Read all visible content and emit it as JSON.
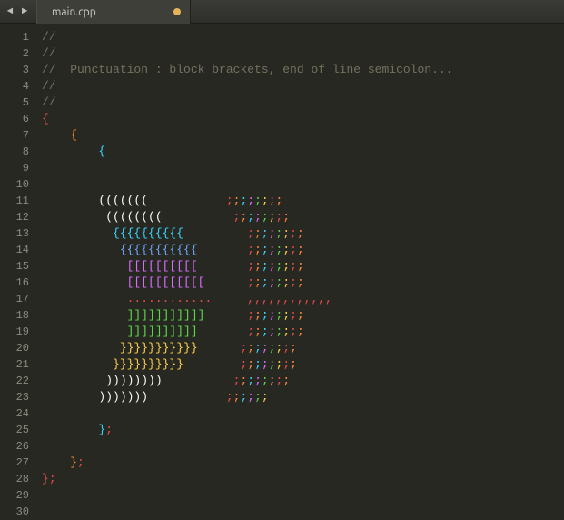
{
  "tabbar": {
    "prev_arrow": "◄",
    "next_arrow": "►",
    "tab_title": "main.cpp",
    "dirty_tooltip": "Unsaved changes"
  },
  "colors": {
    "accent_orange_dot": "#e6b35a",
    "comment": "#75715e",
    "background": "#272822"
  },
  "editor": {
    "line_count": 30,
    "lines": [
      {
        "kind": "comment",
        "text": "//"
      },
      {
        "kind": "comment",
        "text": "//"
      },
      {
        "kind": "comment",
        "text": "//  Punctuation : block brackets, end of line semicolon..."
      },
      {
        "kind": "comment",
        "text": "//"
      },
      {
        "kind": "comment",
        "text": "//"
      },
      {
        "kind": "code",
        "indent": 0,
        "segments": [
          {
            "c": "red",
            "t": "{"
          }
        ]
      },
      {
        "kind": "code",
        "indent": 4,
        "segments": [
          {
            "c": "orange",
            "t": "{"
          }
        ]
      },
      {
        "kind": "code",
        "indent": 8,
        "segments": [
          {
            "c": "cy",
            "t": "{"
          }
        ]
      },
      {
        "kind": "blank"
      },
      {
        "kind": "blank"
      },
      {
        "kind": "code",
        "indent": 8,
        "segments": [
          {
            "c": "wi",
            "t": "((((((("
          },
          {
            "c": "wi",
            "t": "           "
          },
          {
            "c": "red",
            "t": ";"
          },
          {
            "c": "orange",
            "t": ";"
          },
          {
            "c": "cy",
            "t": ";"
          },
          {
            "c": "mg",
            "t": ";"
          },
          {
            "c": "gr",
            "t": ";"
          },
          {
            "c": "yl",
            "t": ";"
          },
          {
            "c": "red",
            "t": ";"
          },
          {
            "c": "orange",
            "t": ";"
          }
        ]
      },
      {
        "kind": "code",
        "indent": 9,
        "segments": [
          {
            "c": "wi",
            "t": "(((((((("
          },
          {
            "c": "wi",
            "t": "          "
          },
          {
            "c": "red",
            "t": ";"
          },
          {
            "c": "orange",
            "t": ";"
          },
          {
            "c": "cy",
            "t": ";"
          },
          {
            "c": "mg",
            "t": ";"
          },
          {
            "c": "gr",
            "t": ";"
          },
          {
            "c": "yl",
            "t": ";"
          },
          {
            "c": "red",
            "t": ";"
          },
          {
            "c": "orange",
            "t": ";"
          }
        ]
      },
      {
        "kind": "code",
        "indent": 10,
        "segments": [
          {
            "c": "cy",
            "t": "{{{{{{{{{{"
          },
          {
            "c": "wi",
            "t": "         "
          },
          {
            "c": "red",
            "t": ";"
          },
          {
            "c": "orange",
            "t": ";"
          },
          {
            "c": "cy",
            "t": ";"
          },
          {
            "c": "mg",
            "t": ";"
          },
          {
            "c": "gr",
            "t": ";"
          },
          {
            "c": "yl",
            "t": ";"
          },
          {
            "c": "red",
            "t": ";"
          },
          {
            "c": "orange",
            "t": ";"
          }
        ]
      },
      {
        "kind": "code",
        "indent": 11,
        "segments": [
          {
            "c": "d2b",
            "t": "{{{{{{{{{{{"
          },
          {
            "c": "wi",
            "t": "       "
          },
          {
            "c": "red",
            "t": ";"
          },
          {
            "c": "orange",
            "t": ";"
          },
          {
            "c": "cy",
            "t": ";"
          },
          {
            "c": "mg",
            "t": ";"
          },
          {
            "c": "gr",
            "t": ";"
          },
          {
            "c": "yl",
            "t": ";"
          },
          {
            "c": "red",
            "t": ";"
          },
          {
            "c": "orange",
            "t": ";"
          }
        ]
      },
      {
        "kind": "code",
        "indent": 12,
        "segments": [
          {
            "c": "mg",
            "t": "[[[[[[[[[["
          },
          {
            "c": "wi",
            "t": "       "
          },
          {
            "c": "red",
            "t": ";"
          },
          {
            "c": "orange",
            "t": ";"
          },
          {
            "c": "cy",
            "t": ";"
          },
          {
            "c": "mg",
            "t": ";"
          },
          {
            "c": "gr",
            "t": ";"
          },
          {
            "c": "yl",
            "t": ";"
          },
          {
            "c": "red",
            "t": ";"
          },
          {
            "c": "orange",
            "t": ";"
          }
        ]
      },
      {
        "kind": "code",
        "indent": 12,
        "segments": [
          {
            "c": "mg",
            "t": "[[[[[[[[[[["
          },
          {
            "c": "wi",
            "t": "      "
          },
          {
            "c": "red",
            "t": ";"
          },
          {
            "c": "orange",
            "t": ";"
          },
          {
            "c": "cy",
            "t": ";"
          },
          {
            "c": "mg",
            "t": ";"
          },
          {
            "c": "gr",
            "t": ";"
          },
          {
            "c": "yl",
            "t": ";"
          },
          {
            "c": "red",
            "t": ";"
          },
          {
            "c": "orange",
            "t": ";"
          }
        ]
      },
      {
        "kind": "code",
        "indent": 12,
        "segments": [
          {
            "c": "red",
            "t": "............"
          },
          {
            "c": "wi",
            "t": "     "
          },
          {
            "c": "red",
            "t": ",,,,,,,,,,,,"
          }
        ]
      },
      {
        "kind": "code",
        "indent": 12,
        "segments": [
          {
            "c": "gr",
            "t": "]]]]]]]]]]]"
          },
          {
            "c": "wi",
            "t": "      "
          },
          {
            "c": "red",
            "t": ";"
          },
          {
            "c": "orange",
            "t": ";"
          },
          {
            "c": "cy",
            "t": ";"
          },
          {
            "c": "mg",
            "t": ";"
          },
          {
            "c": "gr",
            "t": ";"
          },
          {
            "c": "yl",
            "t": ";"
          },
          {
            "c": "red",
            "t": ";"
          },
          {
            "c": "orange",
            "t": ";"
          }
        ]
      },
      {
        "kind": "code",
        "indent": 12,
        "segments": [
          {
            "c": "gr",
            "t": "]]]]]]]]]]"
          },
          {
            "c": "wi",
            "t": "       "
          },
          {
            "c": "red",
            "t": ";"
          },
          {
            "c": "orange",
            "t": ";"
          },
          {
            "c": "cy",
            "t": ";"
          },
          {
            "c": "mg",
            "t": ";"
          },
          {
            "c": "gr",
            "t": ";"
          },
          {
            "c": "yl",
            "t": ";"
          },
          {
            "c": "red",
            "t": ";"
          },
          {
            "c": "orange",
            "t": ";"
          }
        ]
      },
      {
        "kind": "code",
        "indent": 11,
        "segments": [
          {
            "c": "yl",
            "t": "}}}}}}}}}}}"
          },
          {
            "c": "wi",
            "t": "      "
          },
          {
            "c": "red",
            "t": ";"
          },
          {
            "c": "orange",
            "t": ";"
          },
          {
            "c": "cy",
            "t": ";"
          },
          {
            "c": "mg",
            "t": ";"
          },
          {
            "c": "gr",
            "t": ";"
          },
          {
            "c": "yl",
            "t": ";"
          },
          {
            "c": "red",
            "t": ";"
          },
          {
            "c": "orange",
            "t": ";"
          }
        ]
      },
      {
        "kind": "code",
        "indent": 10,
        "segments": [
          {
            "c": "yl",
            "t": "}}}}}}}}}}"
          },
          {
            "c": "wi",
            "t": "        "
          },
          {
            "c": "red",
            "t": ";"
          },
          {
            "c": "orange",
            "t": ";"
          },
          {
            "c": "cy",
            "t": ";"
          },
          {
            "c": "mg",
            "t": ";"
          },
          {
            "c": "gr",
            "t": ";"
          },
          {
            "c": "yl",
            "t": ";"
          },
          {
            "c": "red",
            "t": ";"
          },
          {
            "c": "orange",
            "t": ";"
          }
        ]
      },
      {
        "kind": "code",
        "indent": 9,
        "segments": [
          {
            "c": "wi",
            "t": "))))))))"
          },
          {
            "c": "wi",
            "t": "          "
          },
          {
            "c": "red",
            "t": ";"
          },
          {
            "c": "orange",
            "t": ";"
          },
          {
            "c": "cy",
            "t": ";"
          },
          {
            "c": "mg",
            "t": ";"
          },
          {
            "c": "gr",
            "t": ";"
          },
          {
            "c": "yl",
            "t": ";"
          },
          {
            "c": "red",
            "t": ";"
          },
          {
            "c": "orange",
            "t": ";"
          }
        ]
      },
      {
        "kind": "code",
        "indent": 8,
        "segments": [
          {
            "c": "wi",
            "t": ")))))))"
          },
          {
            "c": "wi",
            "t": "           "
          },
          {
            "c": "red",
            "t": ";"
          },
          {
            "c": "orange",
            "t": ";"
          },
          {
            "c": "cy",
            "t": ";"
          },
          {
            "c": "mg",
            "t": ";"
          },
          {
            "c": "gr",
            "t": ";"
          },
          {
            "c": "yl",
            "t": ";"
          }
        ]
      },
      {
        "kind": "blank"
      },
      {
        "kind": "code",
        "indent": 8,
        "segments": [
          {
            "c": "cy",
            "t": "}"
          },
          {
            "c": "red",
            "t": ";"
          }
        ]
      },
      {
        "kind": "blank"
      },
      {
        "kind": "code",
        "indent": 4,
        "segments": [
          {
            "c": "orange",
            "t": "}"
          },
          {
            "c": "red",
            "t": ";"
          }
        ]
      },
      {
        "kind": "code",
        "indent": 0,
        "segments": [
          {
            "c": "red",
            "t": "}"
          },
          {
            "c": "red",
            "t": ";"
          }
        ]
      },
      {
        "kind": "blank"
      },
      {
        "kind": "blank"
      }
    ]
  }
}
